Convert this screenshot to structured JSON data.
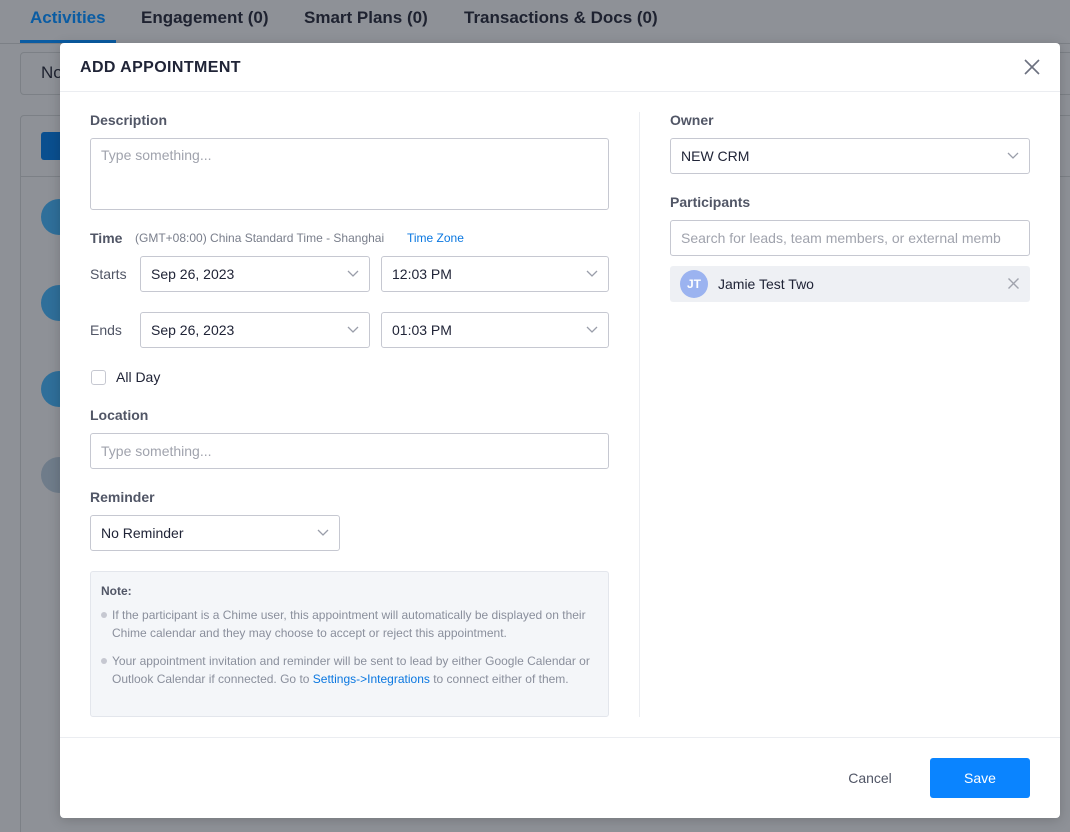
{
  "background": {
    "tabs": [
      {
        "label": "Activities"
      },
      {
        "label": "Engagement (0)"
      },
      {
        "label": "Smart Plans (0)"
      },
      {
        "label": "Transactions & Docs (0)"
      }
    ],
    "card_text": "No"
  },
  "modal": {
    "title": "ADD APPOINTMENT",
    "description": {
      "label": "Description",
      "placeholder": "Type something..."
    },
    "time": {
      "label": "Time",
      "timezone_text": "(GMT+08:00) China Standard Time - Shanghai",
      "timezone_link": "Time Zone",
      "starts_label": "Starts",
      "start_date": "Sep 26, 2023",
      "start_time": "12:03 PM",
      "ends_label": "Ends",
      "end_date": "Sep 26, 2023",
      "end_time": "01:03 PM"
    },
    "all_day": {
      "label": "All Day",
      "checked": false
    },
    "location": {
      "label": "Location",
      "placeholder": "Type something..."
    },
    "reminder": {
      "label": "Reminder",
      "value": "No Reminder"
    },
    "note": {
      "title": "Note:",
      "item1": "If the participant is a Chime user, this appointment will automatically be displayed on their Chime calendar and they may choose to accept or reject this appointment.",
      "item2_before": "Your appointment invitation and reminder will be sent to lead by either Google Calendar or Outlook Calendar if connected. Go to ",
      "item2_link": "Settings->Integrations",
      "item2_after": " to connect either of them."
    },
    "owner": {
      "label": "Owner",
      "value": "NEW CRM"
    },
    "participants": {
      "label": "Participants",
      "placeholder": "Search for leads, team members, or external memb",
      "items": [
        {
          "initials": "JT",
          "name": "Jamie Test Two"
        }
      ]
    },
    "footer": {
      "cancel": "Cancel",
      "save": "Save"
    },
    "colors": {
      "primary": "#0a84ff",
      "link": "#0a77e0",
      "avatar": "#9bb3f0"
    }
  }
}
